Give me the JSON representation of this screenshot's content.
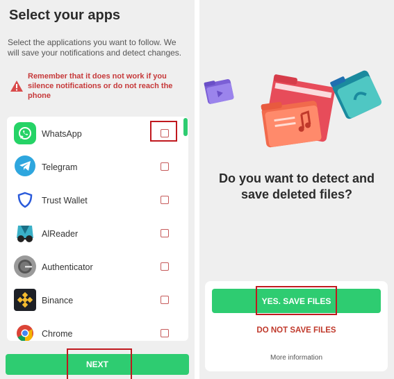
{
  "select_apps": {
    "title": "Select your apps",
    "subtitle": "Select the applications you want to follow. We will save your notifications and detect changes.",
    "warning": "Remember that it does not work if you silence notifications or do not reach the phone",
    "apps": [
      {
        "name": "WhatsApp",
        "icon": "whatsapp-icon",
        "checked": false
      },
      {
        "name": "Telegram",
        "icon": "telegram-icon",
        "checked": false
      },
      {
        "name": "Trust Wallet",
        "icon": "trust-wallet-icon",
        "checked": false
      },
      {
        "name": "AlReader",
        "icon": "alreader-icon",
        "checked": false
      },
      {
        "name": "Authenticator",
        "icon": "authenticator-icon",
        "checked": false
      },
      {
        "name": "Binance",
        "icon": "binance-icon",
        "checked": false
      },
      {
        "name": "Chrome",
        "icon": "chrome-icon",
        "checked": false
      }
    ],
    "next_label": "NEXT"
  },
  "detect_files": {
    "question": "Do you want to detect and save deleted files?",
    "yes_label": "YES. SAVE FILES",
    "no_label": "DO NOT SAVE FILES",
    "more_label": "More information"
  },
  "colors": {
    "accent_green": "#2ecc71",
    "warning_red": "#c6393a",
    "highlight_red": "#c0181e",
    "background": "#efefef"
  }
}
